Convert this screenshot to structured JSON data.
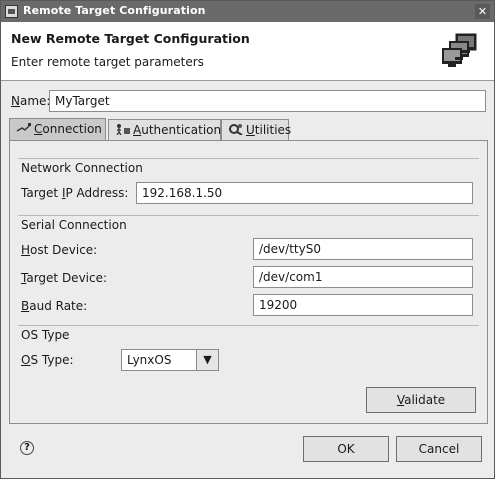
{
  "window": {
    "title": "Remote Target Configuration",
    "close_glyph": "✕"
  },
  "banner": {
    "heading": "New Remote Target Configuration",
    "subtitle": "Enter remote target parameters",
    "icon": "network-monitors-icon"
  },
  "name_field": {
    "label_mnemonic": "N",
    "label_rest": "ame:",
    "value": "MyTarget"
  },
  "tabs": [
    {
      "mnemonic": "C",
      "rest": "onnection",
      "icon": "plug-icon",
      "active": true
    },
    {
      "mnemonic": "A",
      "rest": "uthentication",
      "icon": "key-person-icon",
      "active": false
    },
    {
      "mnemonic": "U",
      "rest": "tilities",
      "icon": "tools-icon",
      "active": false
    }
  ],
  "network_connection": {
    "title": "Network Connection",
    "ip_label_pre": "Target ",
    "ip_label_mnemonic": "I",
    "ip_label_post": "P Address:",
    "ip_value": "192.168.1.50"
  },
  "serial_connection": {
    "title": "Serial Connection",
    "host_mnemonic": "H",
    "host_rest": "ost Device:",
    "host_value": "/dev/ttyS0",
    "target_mnemonic": "T",
    "target_rest": "arget Device:",
    "target_value": "/dev/com1",
    "baud_mnemonic": "B",
    "baud_rest": "aud Rate:",
    "baud_value": "19200"
  },
  "os_type": {
    "title": "OS Type",
    "label_mnemonic": "O",
    "label_rest": "S Type:",
    "value": "LynxOS"
  },
  "buttons": {
    "validate_mnemonic": "V",
    "validate_rest": "alidate",
    "ok": "OK",
    "cancel": "Cancel"
  },
  "help_glyph": "?"
}
